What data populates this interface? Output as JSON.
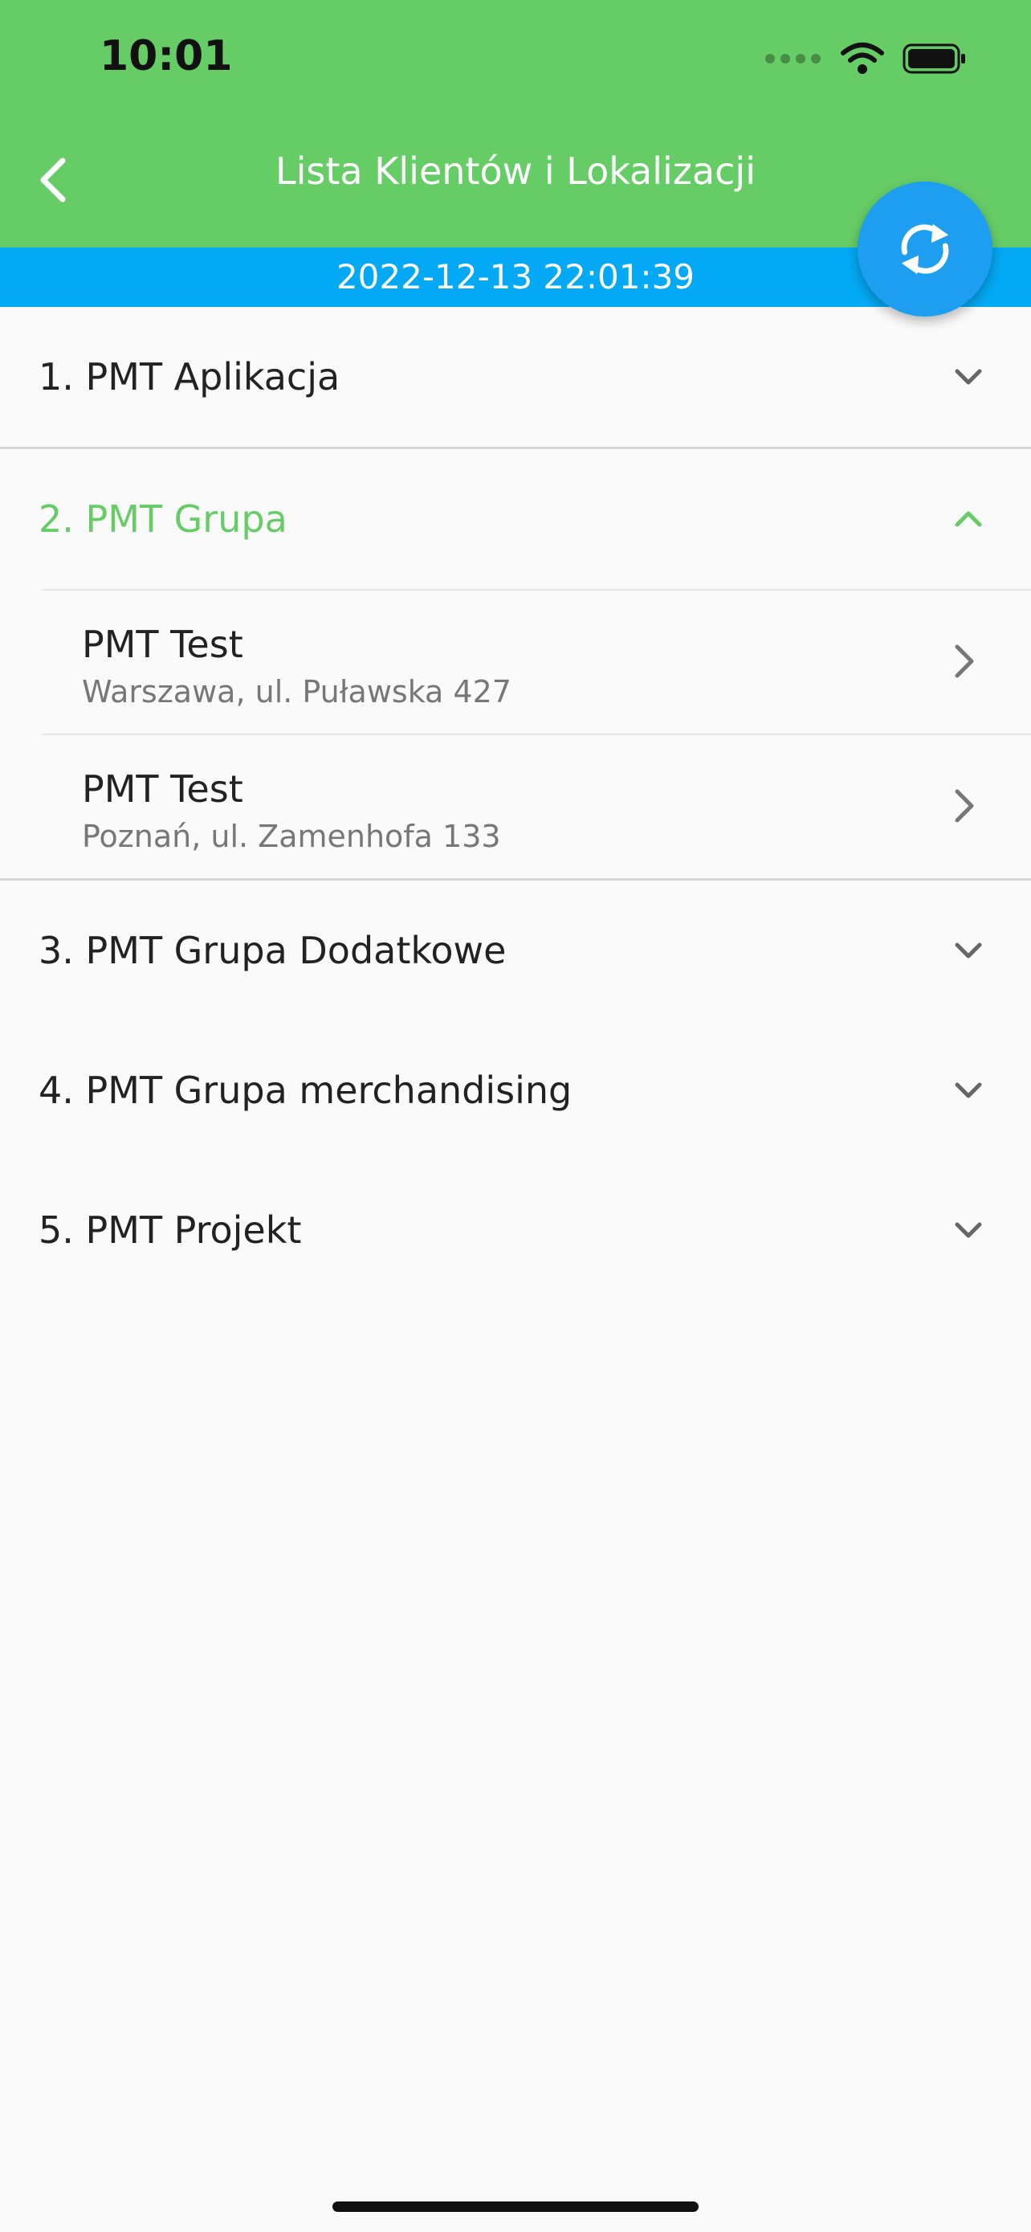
{
  "status_bar": {
    "time": "10:01"
  },
  "header": {
    "title": "Lista Klientów i Lokalizacji",
    "back_icon": "chevron-left-icon"
  },
  "date_bar": {
    "timestamp": "2022-12-13 22:01:39"
  },
  "fab": {
    "icon": "sync-icon"
  },
  "colors": {
    "header_green": "#66cc66",
    "date_bar_blue": "#03a9f4",
    "fab_blue": "#1e9ef0",
    "active_text": "#66cc66"
  },
  "groups": [
    {
      "label": "1.  PMT Aplikacja",
      "expanded": false
    },
    {
      "label": "2.  PMT Grupa",
      "expanded": true,
      "items": [
        {
          "name": "PMT Test",
          "address": "Warszawa, ul. Puławska 427"
        },
        {
          "name": "PMT Test",
          "address": "Poznań, ul. Zamenhofa 133"
        }
      ]
    },
    {
      "label": "3.  PMT Grupa Dodatkowe",
      "expanded": false
    },
    {
      "label": "4.  PMT Grupa merchandising",
      "expanded": false
    },
    {
      "label": "5.  PMT Projekt",
      "expanded": false
    }
  ]
}
